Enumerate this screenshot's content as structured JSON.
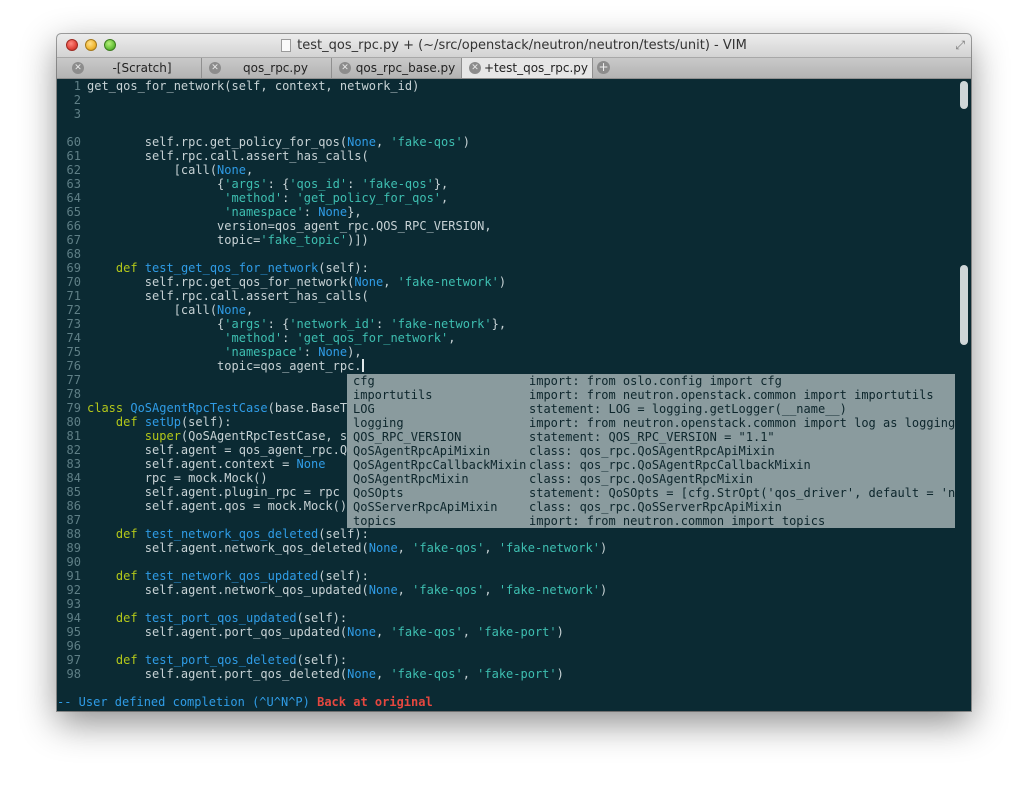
{
  "window": {
    "title": "test_qos_rpc.py + (~/src/openstack/neutron/neutron/tests/unit) - VIM"
  },
  "tabs": [
    {
      "label": "-[Scratch]",
      "active": false
    },
    {
      "label": "qos_rpc.py",
      "active": false
    },
    {
      "label": "qos_rpc_base.py",
      "active": false
    },
    {
      "label": "+test_qos_rpc.py",
      "active": true
    }
  ],
  "editor": {
    "lines": [
      {
        "n": "1",
        "tokens": [
          {
            "t": "get_qos_for_network(self, context, network_id)",
            "c": ""
          }
        ]
      },
      {
        "n": "2",
        "tokens": []
      },
      {
        "n": "3",
        "tokens": []
      },
      {
        "n": "",
        "tokens": []
      },
      {
        "n": "60",
        "tokens": [
          {
            "t": "        self.rpc.get_policy_for_qos(",
            "c": ""
          },
          {
            "t": "None",
            "c": "cnst"
          },
          {
            "t": ", ",
            "c": ""
          },
          {
            "t": "'fake-qos'",
            "c": "str"
          },
          {
            "t": ")",
            "c": ""
          }
        ]
      },
      {
        "n": "61",
        "tokens": [
          {
            "t": "        self.rpc.call.assert_has_calls(",
            "c": ""
          }
        ]
      },
      {
        "n": "62",
        "tokens": [
          {
            "t": "            [call(",
            "c": ""
          },
          {
            "t": "None",
            "c": "cnst"
          },
          {
            "t": ",",
            "c": ""
          }
        ]
      },
      {
        "n": "63",
        "tokens": [
          {
            "t": "                  {",
            "c": ""
          },
          {
            "t": "'args'",
            "c": "str"
          },
          {
            "t": ": {",
            "c": ""
          },
          {
            "t": "'qos_id'",
            "c": "str"
          },
          {
            "t": ": ",
            "c": ""
          },
          {
            "t": "'fake-qos'",
            "c": "str"
          },
          {
            "t": "},",
            "c": ""
          }
        ]
      },
      {
        "n": "64",
        "tokens": [
          {
            "t": "                   ",
            "c": ""
          },
          {
            "t": "'method'",
            "c": "str"
          },
          {
            "t": ": ",
            "c": ""
          },
          {
            "t": "'get_policy_for_qos'",
            "c": "str"
          },
          {
            "t": ",",
            "c": ""
          }
        ]
      },
      {
        "n": "65",
        "tokens": [
          {
            "t": "                   ",
            "c": ""
          },
          {
            "t": "'namespace'",
            "c": "str"
          },
          {
            "t": ": ",
            "c": ""
          },
          {
            "t": "None",
            "c": "cnst"
          },
          {
            "t": "},",
            "c": ""
          }
        ]
      },
      {
        "n": "66",
        "tokens": [
          {
            "t": "                  version=qos_agent_rpc.QOS_RPC_VERSION,",
            "c": ""
          }
        ]
      },
      {
        "n": "67",
        "tokens": [
          {
            "t": "                  topic=",
            "c": ""
          },
          {
            "t": "'fake_topic'",
            "c": "str"
          },
          {
            "t": ")])",
            "c": ""
          }
        ]
      },
      {
        "n": "68",
        "tokens": []
      },
      {
        "n": "69",
        "tokens": [
          {
            "t": "    ",
            "c": ""
          },
          {
            "t": "def",
            "c": "kw"
          },
          {
            "t": " ",
            "c": ""
          },
          {
            "t": "test_get_qos_for_network",
            "c": "fn"
          },
          {
            "t": "(self):",
            "c": ""
          }
        ]
      },
      {
        "n": "70",
        "tokens": [
          {
            "t": "        self.rpc.get_qos_for_network(",
            "c": ""
          },
          {
            "t": "None",
            "c": "cnst"
          },
          {
            "t": ", ",
            "c": ""
          },
          {
            "t": "'fake-network'",
            "c": "str"
          },
          {
            "t": ")",
            "c": ""
          }
        ]
      },
      {
        "n": "71",
        "tokens": [
          {
            "t": "        self.rpc.call.assert_has_calls(",
            "c": ""
          }
        ]
      },
      {
        "n": "72",
        "tokens": [
          {
            "t": "            [call(",
            "c": ""
          },
          {
            "t": "None",
            "c": "cnst"
          },
          {
            "t": ",",
            "c": ""
          }
        ]
      },
      {
        "n": "73",
        "tokens": [
          {
            "t": "                  {",
            "c": ""
          },
          {
            "t": "'args'",
            "c": "str"
          },
          {
            "t": ": {",
            "c": ""
          },
          {
            "t": "'network_id'",
            "c": "str"
          },
          {
            "t": ": ",
            "c": ""
          },
          {
            "t": "'fake-network'",
            "c": "str"
          },
          {
            "t": "},",
            "c": ""
          }
        ]
      },
      {
        "n": "74",
        "tokens": [
          {
            "t": "                   ",
            "c": ""
          },
          {
            "t": "'method'",
            "c": "str"
          },
          {
            "t": ": ",
            "c": ""
          },
          {
            "t": "'get_qos_for_network'",
            "c": "str"
          },
          {
            "t": ",",
            "c": ""
          }
        ]
      },
      {
        "n": "75",
        "tokens": [
          {
            "t": "                   ",
            "c": ""
          },
          {
            "t": "'namespace'",
            "c": "str"
          },
          {
            "t": ": ",
            "c": ""
          },
          {
            "t": "None",
            "c": "cnst"
          },
          {
            "t": "),",
            "c": ""
          }
        ]
      },
      {
        "n": "76",
        "tokens": [
          {
            "t": "                  topic=qos_agent_rpc.",
            "c": ""
          }
        ],
        "cursor": true
      },
      {
        "n": "77",
        "tokens": []
      },
      {
        "n": "78",
        "tokens": []
      },
      {
        "n": "79",
        "tokens": [
          {
            "t": "class",
            "c": "kw"
          },
          {
            "t": " ",
            "c": ""
          },
          {
            "t": "QoSAgentRpcTestCase",
            "c": "fn"
          },
          {
            "t": "(base.BaseTe",
            "c": ""
          }
        ]
      },
      {
        "n": "80",
        "tokens": [
          {
            "t": "    ",
            "c": ""
          },
          {
            "t": "def",
            "c": "kw"
          },
          {
            "t": " ",
            "c": ""
          },
          {
            "t": "setUp",
            "c": "fn"
          },
          {
            "t": "(self):",
            "c": ""
          }
        ]
      },
      {
        "n": "81",
        "tokens": [
          {
            "t": "        ",
            "c": ""
          },
          {
            "t": "super",
            "c": "kw"
          },
          {
            "t": "(QoSAgentRpcTestCase, se",
            "c": ""
          }
        ]
      },
      {
        "n": "82",
        "tokens": [
          {
            "t": "        self.agent = qos_agent_rpc.Qo",
            "c": ""
          }
        ]
      },
      {
        "n": "83",
        "tokens": [
          {
            "t": "        self.agent.context = ",
            "c": ""
          },
          {
            "t": "None",
            "c": "cnst"
          }
        ]
      },
      {
        "n": "84",
        "tokens": [
          {
            "t": "        rpc = mock.Mock()",
            "c": ""
          }
        ]
      },
      {
        "n": "85",
        "tokens": [
          {
            "t": "        self.agent.plugin_rpc = rpc",
            "c": ""
          }
        ]
      },
      {
        "n": "86",
        "tokens": [
          {
            "t": "        self.agent.qos = mock.Mock()",
            "c": ""
          }
        ]
      },
      {
        "n": "87",
        "tokens": []
      },
      {
        "n": "88",
        "tokens": [
          {
            "t": "    ",
            "c": ""
          },
          {
            "t": "def",
            "c": "kw"
          },
          {
            "t": " ",
            "c": ""
          },
          {
            "t": "test_network_qos_deleted",
            "c": "fn"
          },
          {
            "t": "(self):",
            "c": ""
          }
        ]
      },
      {
        "n": "89",
        "tokens": [
          {
            "t": "        self.agent.network_qos_deleted(",
            "c": ""
          },
          {
            "t": "None",
            "c": "cnst"
          },
          {
            "t": ", ",
            "c": ""
          },
          {
            "t": "'fake-qos'",
            "c": "str"
          },
          {
            "t": ", ",
            "c": ""
          },
          {
            "t": "'fake-network'",
            "c": "str"
          },
          {
            "t": ")",
            "c": ""
          }
        ]
      },
      {
        "n": "90",
        "tokens": []
      },
      {
        "n": "91",
        "tokens": [
          {
            "t": "    ",
            "c": ""
          },
          {
            "t": "def",
            "c": "kw"
          },
          {
            "t": " ",
            "c": ""
          },
          {
            "t": "test_network_qos_updated",
            "c": "fn"
          },
          {
            "t": "(self):",
            "c": ""
          }
        ]
      },
      {
        "n": "92",
        "tokens": [
          {
            "t": "        self.agent.network_qos_updated(",
            "c": ""
          },
          {
            "t": "None",
            "c": "cnst"
          },
          {
            "t": ", ",
            "c": ""
          },
          {
            "t": "'fake-qos'",
            "c": "str"
          },
          {
            "t": ", ",
            "c": ""
          },
          {
            "t": "'fake-network'",
            "c": "str"
          },
          {
            "t": ")",
            "c": ""
          }
        ]
      },
      {
        "n": "93",
        "tokens": []
      },
      {
        "n": "94",
        "tokens": [
          {
            "t": "    ",
            "c": ""
          },
          {
            "t": "def",
            "c": "kw"
          },
          {
            "t": " ",
            "c": ""
          },
          {
            "t": "test_port_qos_updated",
            "c": "fn"
          },
          {
            "t": "(self):",
            "c": ""
          }
        ]
      },
      {
        "n": "95",
        "tokens": [
          {
            "t": "        self.agent.port_qos_updated(",
            "c": ""
          },
          {
            "t": "None",
            "c": "cnst"
          },
          {
            "t": ", ",
            "c": ""
          },
          {
            "t": "'fake-qos'",
            "c": "str"
          },
          {
            "t": ", ",
            "c": ""
          },
          {
            "t": "'fake-port'",
            "c": "str"
          },
          {
            "t": ")",
            "c": ""
          }
        ]
      },
      {
        "n": "96",
        "tokens": []
      },
      {
        "n": "97",
        "tokens": [
          {
            "t": "    ",
            "c": ""
          },
          {
            "t": "def",
            "c": "kw"
          },
          {
            "t": " ",
            "c": ""
          },
          {
            "t": "test_port_qos_deleted",
            "c": "fn"
          },
          {
            "t": "(self):",
            "c": ""
          }
        ]
      },
      {
        "n": "98",
        "tokens": [
          {
            "t": "        self.agent.port_qos_deleted(",
            "c": ""
          },
          {
            "t": "None",
            "c": "cnst"
          },
          {
            "t": ", ",
            "c": ""
          },
          {
            "t": "'fake-qos'",
            "c": "str"
          },
          {
            "t": ", ",
            "c": ""
          },
          {
            "t": "'fake-port'",
            "c": "str"
          },
          {
            "t": ")",
            "c": ""
          }
        ]
      }
    ]
  },
  "completion": {
    "items": [
      {
        "word": "cfg",
        "menu": "import: from oslo.config import cfg"
      },
      {
        "word": "importutils",
        "menu": "import: from neutron.openstack.common import importutils"
      },
      {
        "word": "LOG",
        "menu": "statement: LOG = logging.getLogger(__name__)"
      },
      {
        "word": "logging",
        "menu": "import: from neutron.openstack.common import log as logging"
      },
      {
        "word": "QOS_RPC_VERSION",
        "menu": "statement: QOS_RPC_VERSION = \"1.1\""
      },
      {
        "word": "QoSAgentRpcApiMixin",
        "menu": "class: qos_rpc.QoSAgentRpcApiMixin"
      },
      {
        "word": "QoSAgentRpcCallbackMixin",
        "menu": "class: qos_rpc.QoSAgentRpcCallbackMixin"
      },
      {
        "word": "QoSAgentRpcMixin",
        "menu": "class: qos_rpc.QoSAgentRpcMixin"
      },
      {
        "word": "QoSOpts",
        "menu": "statement: QoSOpts = [cfg.StrOpt('qos_driver', default = 'neu"
      },
      {
        "word": "QoSServerRpcApiMixin",
        "menu": "class: qos_rpc.QoSServerRpcApiMixin"
      },
      {
        "word": "topics",
        "menu": "import: from neutron.common import topics"
      }
    ]
  },
  "status": {
    "mode_text": "-- User defined completion (^U^N^P) ",
    "message": "Back at original"
  },
  "colors": {
    "background": "#0b2a33",
    "keyword": "#b3c71a",
    "function": "#2f9ce6",
    "string": "#3ebfb1",
    "error": "#e5473f",
    "popup": "#8a9b9e"
  }
}
